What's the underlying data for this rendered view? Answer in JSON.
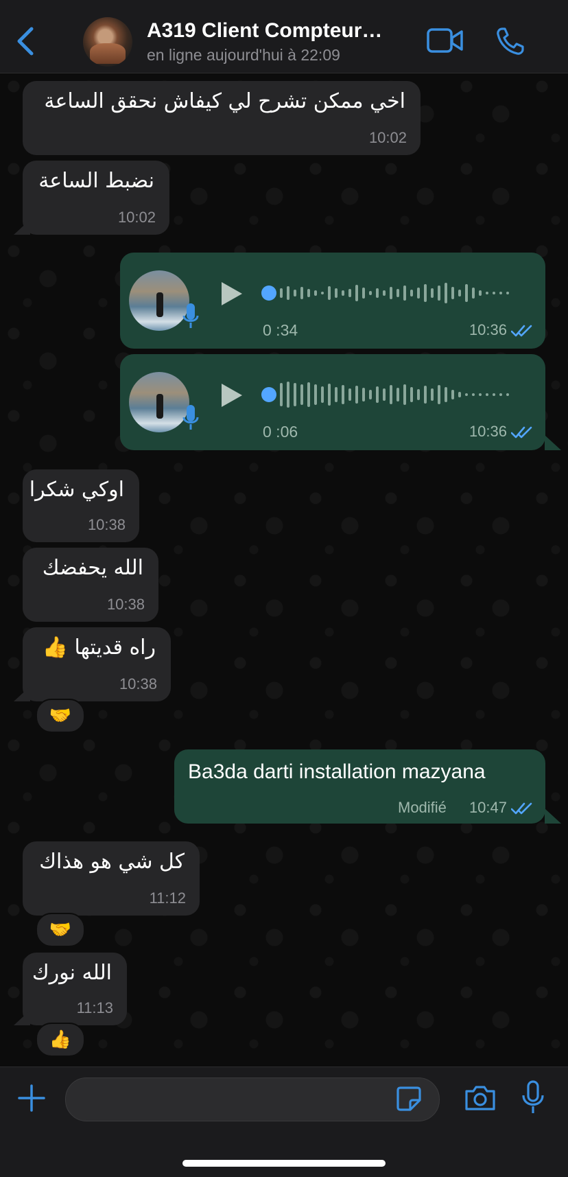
{
  "header": {
    "back_label": "",
    "title": "A319 Client Compteur…",
    "subtitle": "en ligne aujourd'hui à 22:09",
    "icons": [
      "back-chevron-icon",
      "video-call-icon",
      "phone-call-icon"
    ]
  },
  "colors": {
    "accent": "#3a8fe0",
    "incoming_bubble": "#262628",
    "outgoing_bubble": "#1e4538",
    "read_ticks": "#53a6ff"
  },
  "messages": [
    {
      "dir": "in",
      "text": "اخي ممكن تشرح لي كيفاش نحقق الساعة",
      "time": "10:02"
    },
    {
      "dir": "in",
      "text": "نضبط الساعة",
      "time": "10:02"
    },
    {
      "dir": "out",
      "type": "voice",
      "duration": "0 :34",
      "time": "10:36",
      "status": "read"
    },
    {
      "dir": "out",
      "type": "voice",
      "duration": "0 :06",
      "time": "10:36",
      "status": "read"
    },
    {
      "dir": "in",
      "text": "اوكي شكرا",
      "time": "10:38"
    },
    {
      "dir": "in",
      "text": "الله يحفضك",
      "time": "10:38"
    },
    {
      "dir": "in",
      "text": "راه قديتها 👍",
      "time": "10:38",
      "reaction": "🤝"
    },
    {
      "dir": "out",
      "text": "Ba3da darti installation mazyana",
      "edited_label": "Modifié",
      "time": "10:47",
      "status": "read"
    },
    {
      "dir": "in",
      "text": "كل شي هو هذاك",
      "time": "11:12",
      "reaction": "🤝"
    },
    {
      "dir": "in",
      "text": "الله نورك",
      "time": "11:13",
      "reaction": "👍"
    }
  ],
  "composer": {
    "placeholder": "",
    "icons": [
      "plus-icon",
      "sticker-icon",
      "camera-icon",
      "microphone-icon"
    ]
  }
}
